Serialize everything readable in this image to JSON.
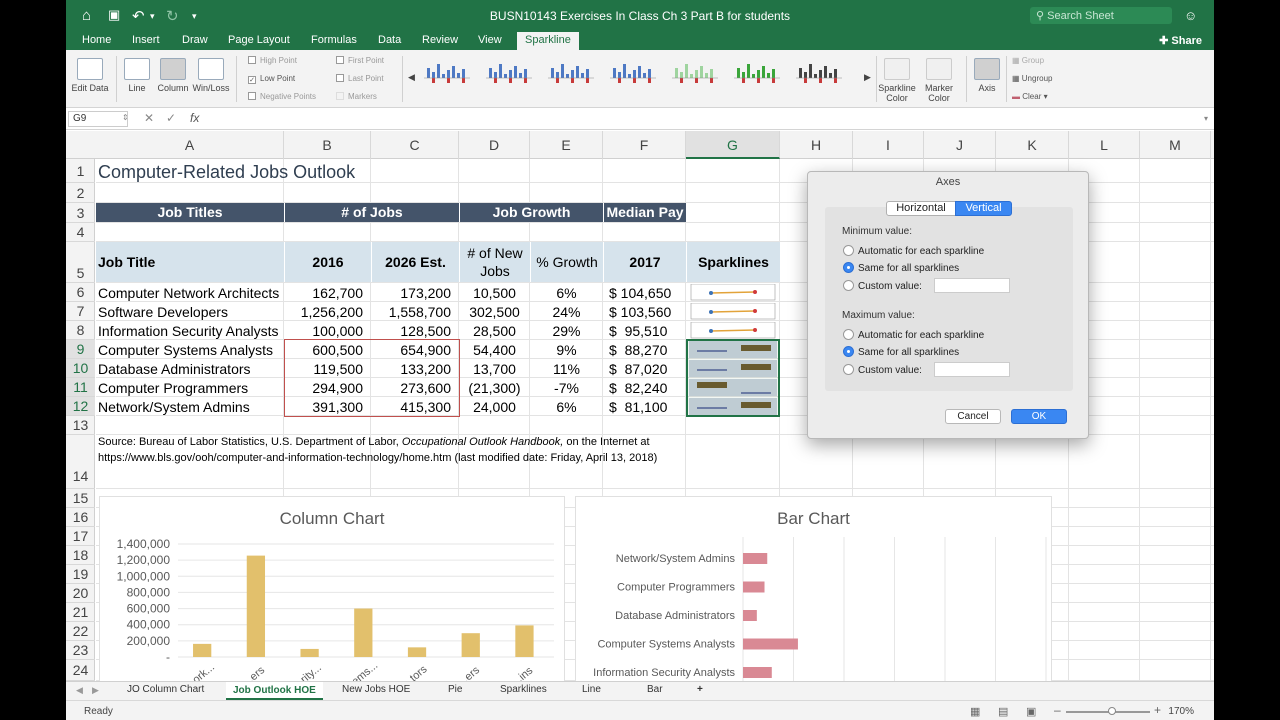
{
  "window": {
    "title": "BUSN10143 Exercises In Class Ch 3 Part B for students",
    "search_placeholder": "Search Sheet"
  },
  "ribbon_tabs": [
    "Home",
    "Insert",
    "Draw",
    "Page Layout",
    "Formulas",
    "Data",
    "Review",
    "View",
    "Sparkline"
  ],
  "share_label": "Share",
  "ribbon": {
    "edit_data": "Edit Data",
    "line": "Line",
    "column": "Column",
    "win_loss": "Win/Loss",
    "high_point": "High Point",
    "low_point": "Low Point",
    "negative_points": "Negative Points",
    "first_point": "First Point",
    "last_point": "Last Point",
    "markers": "Markers",
    "sparkline_color": "Sparkline Color",
    "marker_color": "Marker Color",
    "axis": "Axis",
    "group": "Group",
    "ungroup": "Ungroup",
    "clear": "Clear"
  },
  "formula_bar": {
    "name_box": "G9",
    "fx": "fx",
    "formula": ""
  },
  "columns": [
    "A",
    "B",
    "C",
    "D",
    "E",
    "F",
    "G",
    "H",
    "I",
    "J",
    "K",
    "L",
    "M"
  ],
  "rows": [
    "1",
    "2",
    "3",
    "4",
    "5",
    "6",
    "7",
    "8",
    "9",
    "10",
    "11",
    "12",
    "13",
    "14",
    "15",
    "16",
    "17",
    "18",
    "19",
    "20",
    "21",
    "22",
    "23",
    "24"
  ],
  "sheet": {
    "title": "Computer-Related Jobs Outlook",
    "group_headers": {
      "job_titles": "Job Titles",
      "num_jobs": "# of Jobs",
      "job_growth": "Job Growth",
      "median_pay": "Median Pay"
    },
    "col_headers": {
      "job_title": "Job Title",
      "y2016": "2016",
      "y2026": "2026 Est.",
      "new_jobs": "# of New Jobs",
      "pct_growth": "% Growth",
      "y2017": "2017",
      "sparklines": "Sparklines"
    },
    "data_rows": [
      {
        "title": "Computer Network Architects",
        "j2016": "162,700",
        "j2026": "173,200",
        "new": "10,500",
        "pct": "6%",
        "pay": "$ 104,650"
      },
      {
        "title": "Software Developers",
        "j2016": "1,256,200",
        "j2026": "1,558,700",
        "new": "302,500",
        "pct": "24%",
        "pay": "$ 103,560"
      },
      {
        "title": "Information Security Analysts",
        "j2016": "100,000",
        "j2026": "128,500",
        "new": "28,500",
        "pct": "29%",
        "pay": "$  95,510"
      },
      {
        "title": "Computer Systems Analysts",
        "j2016": "600,500",
        "j2026": "654,900",
        "new": "54,400",
        "pct": "9%",
        "pay": "$  88,270"
      },
      {
        "title": "Database Administrators",
        "j2016": "119,500",
        "j2026": "133,200",
        "new": "13,700",
        "pct": "11%",
        "pay": "$  87,020"
      },
      {
        "title": "Computer Programmers",
        "j2016": "294,900",
        "j2026": "273,600",
        "new": "(21,300)",
        "pct": "-7%",
        "pay": "$  82,240"
      },
      {
        "title": "Network/System Admins",
        "j2016": "391,300",
        "j2026": "415,300",
        "new": "24,000",
        "pct": "6%",
        "pay": "$  81,100"
      }
    ],
    "source_line1": "Source: Bureau of Labor Statistics, U.S. Department of Labor, ",
    "source_italic": "Occupational Outlook Handbook,",
    "source_line1_end": " on the Internet at",
    "source_line2": "https://www.bls.gov/ooh/computer-and-information-technology/home.htm (last modified date: Friday, April 13, 2018)"
  },
  "chart_data": [
    {
      "type": "bar",
      "title": "Column Chart",
      "categories": [
        "Computer Network Architects",
        "Software Developers",
        "Information Security Analysts",
        "Computer Systems Analysts",
        "Database Administrators",
        "Computer Programmers",
        "Network/System Admins"
      ],
      "tick_labels_visible": [
        "...ork...",
        "...ers",
        "...rity...",
        "...ems...",
        "...tors",
        "...ers",
        "...ins"
      ],
      "values": [
        162700,
        1256200,
        100000,
        600500,
        119500,
        294900,
        391300
      ],
      "y_ticks": [
        "1,400,000",
        "1,200,000",
        "1,000,000",
        "800,000",
        "600,000",
        "400,000",
        "200,000",
        "-"
      ],
      "ylim": [
        0,
        1400000
      ],
      "color": "#e2c06c"
    },
    {
      "type": "bar",
      "orientation": "horizontal",
      "title": "Bar Chart",
      "categories": [
        "Network/System Admins",
        "Computer Programmers",
        "Database Administrators",
        "Computer Systems Analysts",
        "Information Security Analysts"
      ],
      "values": [
        24000,
        21300,
        13700,
        54400,
        28500
      ],
      "xlim": [
        0,
        300000
      ],
      "color": "#d98994"
    }
  ],
  "dialog": {
    "title": "Axes",
    "tab_horizontal": "Horizontal",
    "tab_vertical": "Vertical",
    "min_label": "Minimum value:",
    "max_label": "Maximum value:",
    "opt_auto": "Automatic for each sparkline",
    "opt_same": "Same for all sparklines",
    "opt_custom": "Custom value:",
    "cancel": "Cancel",
    "ok": "OK"
  },
  "sheet_tabs": [
    "JO Column Chart",
    "Job Outlook HOE",
    "New Jobs HOE",
    "Pie",
    "Sparklines",
    "Line",
    "Bar",
    "+"
  ],
  "status": {
    "text": "Ready",
    "zoom": "170%"
  },
  "colors": {
    "excel_green": "#217346",
    "header_blue": "#44546a",
    "header_light": "#d6e3ec",
    "accent_blue": "#3a87f2"
  }
}
